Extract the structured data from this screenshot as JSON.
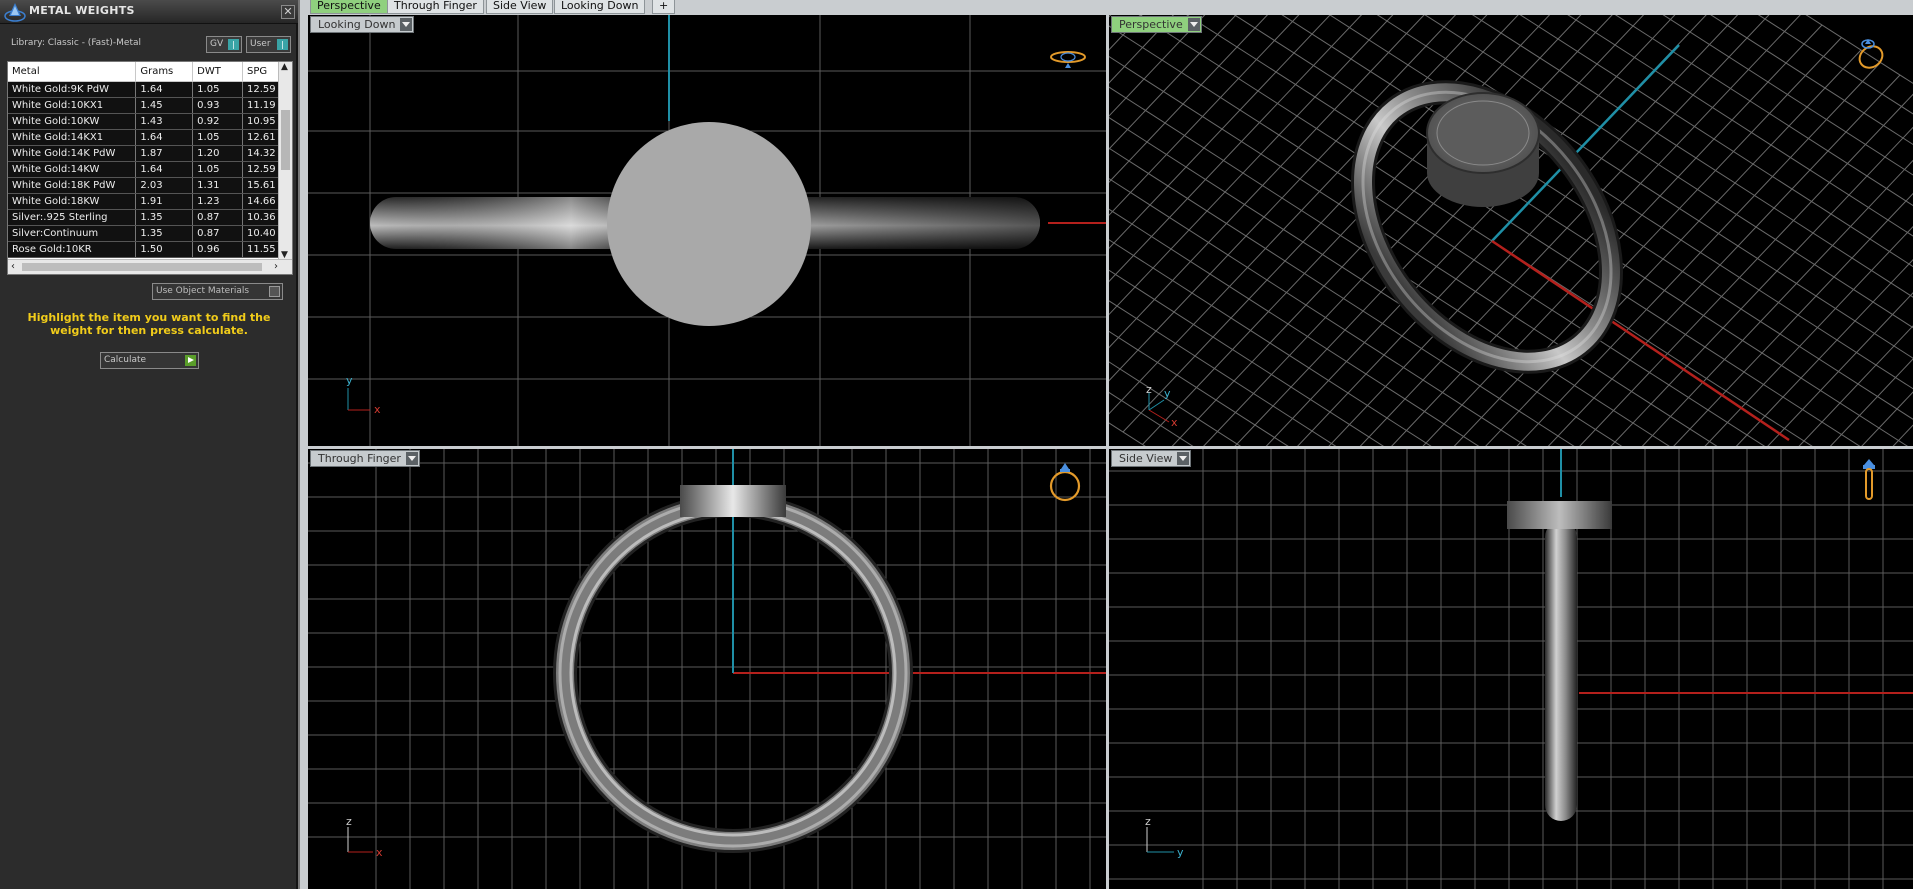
{
  "panel": {
    "title": "METAL WEIGHTS",
    "close": "✕",
    "library": "Library: Classic - (Fast)-Metal",
    "toggle_gv": "GV",
    "toggle_user": "User",
    "table": {
      "headers": [
        "Metal",
        "Grams",
        "DWT",
        "SPG"
      ],
      "rows": [
        [
          "White Gold:9K PdW",
          "1.64",
          "1.05",
          "12.59"
        ],
        [
          "White Gold:10KX1",
          "1.45",
          "0.93",
          "11.19"
        ],
        [
          "White Gold:10KW",
          "1.43",
          "0.92",
          "10.95"
        ],
        [
          "White Gold:14KX1",
          "1.64",
          "1.05",
          "12.61"
        ],
        [
          "White Gold:14K PdW",
          "1.87",
          "1.20",
          "14.32"
        ],
        [
          "White Gold:14KW",
          "1.64",
          "1.05",
          "12.59"
        ],
        [
          "White Gold:18K PdW",
          "2.03",
          "1.31",
          "15.61"
        ],
        [
          "White Gold:18KW",
          "1.91",
          "1.23",
          "14.66"
        ],
        [
          "Silver:.925 Sterling",
          "1.35",
          "0.87",
          "10.36"
        ],
        [
          "Silver:Continuum",
          "1.35",
          "0.87",
          "10.40"
        ],
        [
          "Rose Gold:10KR",
          "1.50",
          "0.96",
          "11.55"
        ]
      ]
    },
    "use_object_materials": "Use Object Materials",
    "hint": "Highlight the item you want to find the weight for then press calculate.",
    "calculate": "Calculate"
  },
  "tabs": [
    {
      "label": "Perspective",
      "active": true
    },
    {
      "label": "Through Finger",
      "active": false
    },
    {
      "label": "Side View",
      "active": false
    },
    {
      "label": "Looking Down",
      "active": false
    },
    {
      "label": "+",
      "active": false
    }
  ],
  "viewports": {
    "top_left": {
      "label": "Looking Down",
      "axis_v": "y",
      "axis_h": "x"
    },
    "top_right": {
      "label": "Perspective",
      "axis_z": "z",
      "axis_y": "y",
      "axis_x": "x"
    },
    "bottom_left": {
      "label": "Through Finger",
      "axis_v": "z",
      "axis_h": "x"
    },
    "bottom_right": {
      "label": "Side View",
      "axis_v": "z",
      "axis_h": "y"
    }
  },
  "colors": {
    "panel_bg": "#2c2c2c",
    "hint_text": "#f1cc1a",
    "active_tab": "#8fd07e",
    "axis_red": "#b4201c",
    "axis_cyan": "#1f8fa6",
    "grid": "#7d7d7d",
    "icon_orange": "#e39a2a"
  },
  "icons": {
    "app_logo": "matrix-logo-icon",
    "view_cube": "ring-orientation-icon"
  }
}
